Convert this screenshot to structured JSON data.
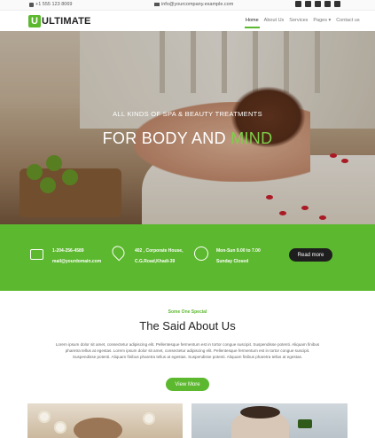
{
  "topbar": {
    "phone": "+1 555 123 8069",
    "email": "info@yourcompany.example.com",
    "social": [
      "facebook-icon",
      "twitter-icon",
      "linkedin-icon",
      "youtube-icon",
      "github-icon"
    ]
  },
  "brand": {
    "mark": "U",
    "name": "ULTIMATE"
  },
  "nav": {
    "items": [
      {
        "label": "Home"
      },
      {
        "label": "About Us"
      },
      {
        "label": "Services"
      },
      {
        "label": "Pages ▾"
      },
      {
        "label": "Contact us"
      }
    ]
  },
  "hero": {
    "subtitle": "ALL KINDS OF SPA & BEAUTY TREATMENTS",
    "title_main": "FOR BODY AND ",
    "title_accent": "MIND"
  },
  "contact": {
    "phone": "1-204-256-4589",
    "email": "mail@yourdomain.com",
    "address_line1": "402 , Corporate House,",
    "address_line2": "C.G.Road,Khadi-39",
    "hours_line1": "Mon-Sun 9.00 to 7.00",
    "hours_line2": "Sunday Closed",
    "button": "Read more"
  },
  "about": {
    "kicker": "Some One Special",
    "title": "The Said About Us",
    "text": "Lorem ipsum dolor sit amet, consectetur adipiscing elit. Pellentesque fermentum est in tortor congue suscipit. Suspendisse potenti. Aliquam finibus pharetra tellus at egestas. Lorem ipsum dolor sit amet, consectetur adipiscing elit. Pellentesque fermentum est in tortor congue suscipit. Suspendisse potenti. Aliquam finibus pharetra tellus at egestas. Suspendisse potenti. Aliquam finibus pharetra tellus at egestas.",
    "button": "View More"
  },
  "colors": {
    "accent": "#5cb82e",
    "dark": "#1e1e1e"
  }
}
